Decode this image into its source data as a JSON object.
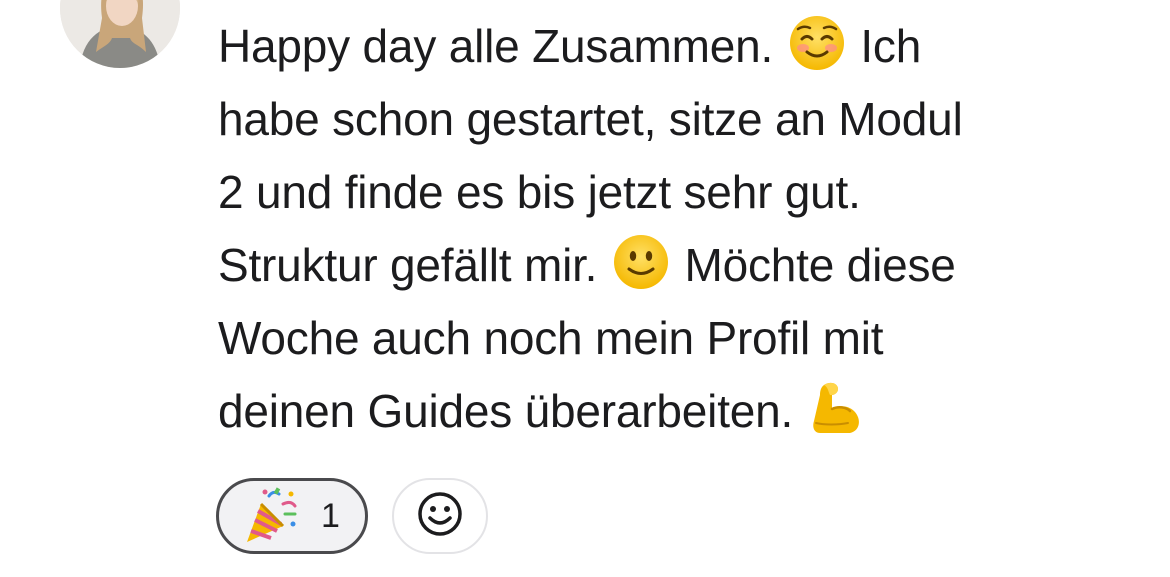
{
  "author": {
    "avatar_icon": "user-avatar-photo"
  },
  "message": {
    "lines": [
      {
        "before": "Happy day alle Zusammen.",
        "emoji": "smiling-blush-emoji",
        "after": "Ich"
      },
      {
        "text": "habe schon gestartet, sitze an Modul"
      },
      {
        "text": "2 und finde es bis jetzt sehr gut."
      },
      {
        "before": "Struktur gefällt mir.",
        "emoji": "slightly-smiling-emoji",
        "after": "Möchte diese"
      },
      {
        "text": "Woche auch noch mein Profil mit"
      },
      {
        "before": "deinen Guides überarbeiten.",
        "emoji": "flexed-biceps-emoji"
      }
    ]
  },
  "reactions": {
    "items": [
      {
        "emoji": "party-popper-emoji",
        "count": "1"
      }
    ],
    "add_icon": "add-reaction-smiley-icon"
  },
  "colors": {
    "text": "#1c1c1e",
    "chip_border": "#4a4a4d",
    "chip_bg": "#f2f2f4",
    "add_border": "#e3e3e6",
    "emoji_yellow": "#ffcc33"
  }
}
